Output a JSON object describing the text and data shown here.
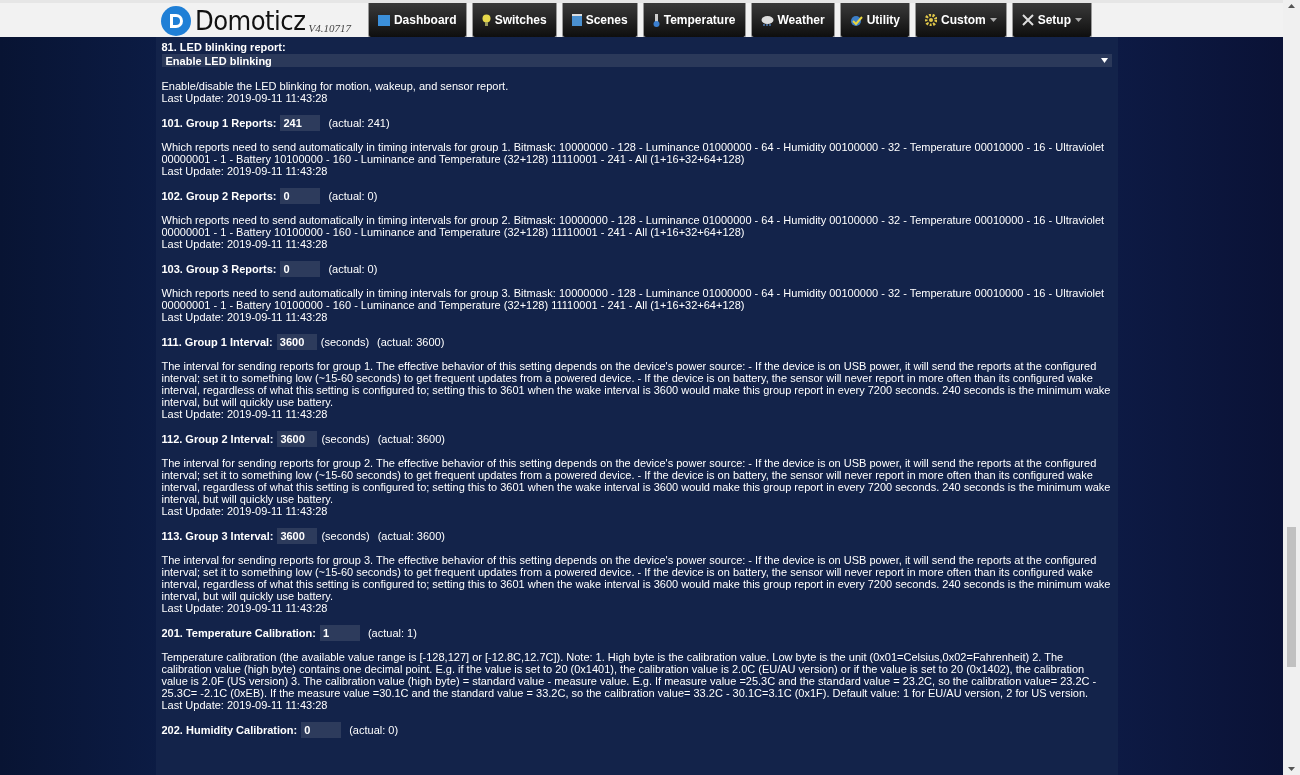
{
  "header": {
    "logo": "Domoticz",
    "version": "V4.10717",
    "nav": [
      {
        "label": "Dashboard",
        "dropdown": false
      },
      {
        "label": "Switches",
        "dropdown": false
      },
      {
        "label": "Scenes",
        "dropdown": false
      },
      {
        "label": "Temperature",
        "dropdown": false
      },
      {
        "label": "Weather",
        "dropdown": false
      },
      {
        "label": "Utility",
        "dropdown": false
      },
      {
        "label": "Custom",
        "dropdown": true
      },
      {
        "label": "Setup",
        "dropdown": true
      }
    ]
  },
  "parameters": [
    {
      "kind": "select",
      "title": "81. LED blinking report:",
      "value": "Enable LED blinking",
      "description": "Enable/disable the LED blinking for motion, wakeup, and sensor report.",
      "last_update": "Last Update: 2019-09-11 11:43:28"
    },
    {
      "kind": "number",
      "title": "101. Group 1 Reports:",
      "value": "241",
      "actual": "(actual: 241)",
      "description": "Which reports need to send automatically in timing intervals for group 1. Bitmask: 10000000 - 128 - Luminance 01000000 - 64 - Humidity 00100000 - 32 - Temperature 00010000 - 16 - Ultraviolet 00000001 - 1 - Battery 10100000 - 160 - Luminance and Temperature (32+128) 11110001 - 241 - All (1+16+32+64+128)",
      "last_update": "Last Update: 2019-09-11 11:43:28"
    },
    {
      "kind": "number",
      "title": "102. Group 2 Reports:",
      "value": "0",
      "actual": "(actual: 0)",
      "description": "Which reports need to send automatically in timing intervals for group 2. Bitmask: 10000000 - 128 - Luminance 01000000 - 64 - Humidity 00100000 - 32 - Temperature 00010000 - 16 - Ultraviolet 00000001 - 1 - Battery 10100000 - 160 - Luminance and Temperature (32+128) 11110001 - 241 - All (1+16+32+64+128)",
      "last_update": "Last Update: 2019-09-11 11:43:28"
    },
    {
      "kind": "number",
      "title": "103. Group 3 Reports:",
      "value": "0",
      "actual": "(actual: 0)",
      "description": "Which reports need to send automatically in timing intervals for group 3. Bitmask: 10000000 - 128 - Luminance 01000000 - 64 - Humidity 00100000 - 32 - Temperature 00010000 - 16 - Ultraviolet 00000001 - 1 - Battery 10100000 - 160 - Luminance and Temperature (32+128) 11110001 - 241 - All (1+16+32+64+128)",
      "last_update": "Last Update: 2019-09-11 11:43:28"
    },
    {
      "kind": "number",
      "title": "111. Group 1 Interval:",
      "value": "3600",
      "unit": "(seconds)",
      "actual": "(actual: 3600)",
      "description": "The interval for sending reports for group 1. The effective behavior of this setting depends on the device's power source: - If the device is on USB power, it will send the reports at the configured interval; set it to something low (~15-60 seconds) to get frequent updates from a powered device. - If the device is on battery, the sensor will never report in more often than its configured wake interval, regardless of what this setting is configured to; setting this to 3601 when the wake interval is 3600 would make this group report in every 7200 seconds. 240 seconds is the minimum wake interval, but will quickly use battery.",
      "last_update": "Last Update: 2019-09-11 11:43:28"
    },
    {
      "kind": "number",
      "title": "112. Group 2 Interval:",
      "value": "3600",
      "unit": "(seconds)",
      "actual": "(actual: 3600)",
      "description": "The interval for sending reports for group 2. The effective behavior of this setting depends on the device's power source: - If the device is on USB power, it will send the reports at the configured interval; set it to something low (~15-60 seconds) to get frequent updates from a powered device. - If the device is on battery, the sensor will never report in more often than its configured wake interval, regardless of what this setting is configured to; setting this to 3601 when the wake interval is 3600 would make this group report in every 7200 seconds. 240 seconds is the minimum wake interval, but will quickly use battery.",
      "last_update": "Last Update: 2019-09-11 11:43:28"
    },
    {
      "kind": "number",
      "title": "113. Group 3 Interval:",
      "value": "3600",
      "unit": "(seconds)",
      "actual": "(actual: 3600)",
      "description": "The interval for sending reports for group 3. The effective behavior of this setting depends on the device's power source: - If the device is on USB power, it will send the reports at the configured interval; set it to something low (~15-60 seconds) to get frequent updates from a powered device. - If the device is on battery, the sensor will never report in more often than its configured wake interval, regardless of what this setting is configured to; setting this to 3601 when the wake interval is 3600 would make this group report in every 7200 seconds. 240 seconds is the minimum wake interval, but will quickly use battery.",
      "last_update": "Last Update: 2019-09-11 11:43:28"
    },
    {
      "kind": "number",
      "title": "201. Temperature Calibration:",
      "value": "1",
      "actual": "(actual: 1)",
      "description": "Temperature calibration (the available value range is [-128,127] or [-12.8C,12.7C]). Note: 1. High byte is the calibration value. Low byte is the unit (0x01=Celsius,0x02=Fahrenheit) 2. The calibration value (high byte) contains one decimal point. E.g. if the value is set to 20 (0x1401), the calibration value is 2.0C (EU/AU version) or if the value is set to 20 (0x1402), the calibration value is 2.0F (US version) 3. The calibration value (high byte) = standard value - measure value. E.g. If measure value =25.3C and the standard value = 23.2C, so the calibration value= 23.2C - 25.3C= -2.1C (0xEB). If the measure value =30.1C and the standard value = 33.2C, so the calibration value= 33.2C - 30.1C=3.1C (0x1F). Default value: 1 for EU/AU version, 2 for US version.",
      "last_update": "Last Update: 2019-09-11 11:43:28"
    },
    {
      "kind": "number",
      "title": "202. Humidity Calibration:",
      "value": "0",
      "actual": "(actual: 0)"
    }
  ]
}
